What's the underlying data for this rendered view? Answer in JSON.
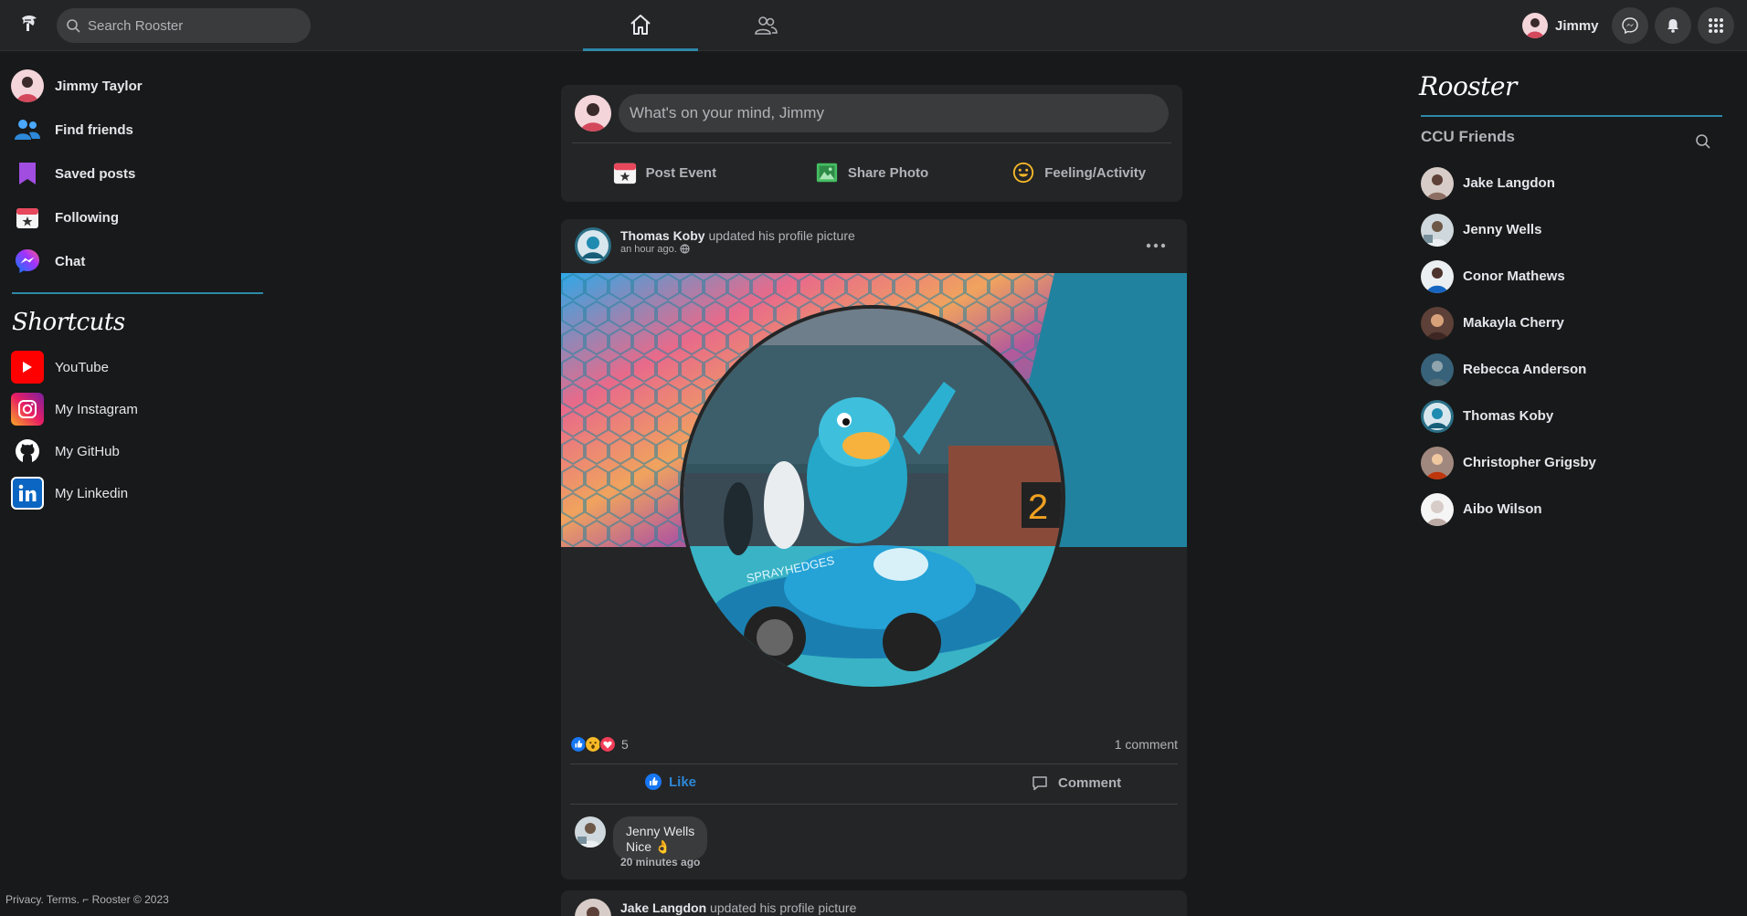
{
  "app": {
    "name": "Rooster"
  },
  "search": {
    "placeholder": "Search Rooster"
  },
  "header": {
    "user_name": "Jimmy"
  },
  "left_nav": [
    {
      "label": "Jimmy Taylor",
      "icon": "avatar"
    },
    {
      "label": "Find friends",
      "icon": "people-icon"
    },
    {
      "label": "Saved posts",
      "icon": "bookmark-icon"
    },
    {
      "label": "Following",
      "icon": "calendar-star-icon"
    },
    {
      "label": "Chat",
      "icon": "messenger-icon"
    }
  ],
  "shortcuts": {
    "title": "Shortcuts",
    "items": [
      {
        "label": "YouTube",
        "icon": "youtube-icon"
      },
      {
        "label": "My Instagram",
        "icon": "instagram-icon"
      },
      {
        "label": "My GitHub",
        "icon": "github-icon"
      },
      {
        "label": "My Linkedin",
        "icon": "linkedin-icon"
      }
    ]
  },
  "footer": {
    "text": "Privacy. Terms. ⌐ Rooster © 2023"
  },
  "composer": {
    "placeholder": "What's on your mind, Jimmy",
    "actions": [
      {
        "label": "Post Event",
        "icon": "calendar-star-icon"
      },
      {
        "label": "Share Photo",
        "icon": "photo-icon"
      },
      {
        "label": "Feeling/Activity",
        "icon": "smiley-icon"
      }
    ]
  },
  "post": {
    "author": "Thomas Koby",
    "action": "updated his profile picture",
    "time": "an hour ago.",
    "reaction_count": "5",
    "comment_count": "1 comment",
    "like_label": "Like",
    "comment_label": "Comment",
    "comments": [
      {
        "author": "Jenny Wells",
        "text": "Nice 👌",
        "time": "20 minutes ago"
      }
    ]
  },
  "post2": {
    "author": "Jake Langdon",
    "action": "updated his profile picture"
  },
  "right": {
    "title": "Rooster",
    "friends_title": "CCU Friends",
    "friends": [
      {
        "name": "Jake Langdon"
      },
      {
        "name": "Jenny Wells"
      },
      {
        "name": "Conor Mathews"
      },
      {
        "name": "Makayla Cherry"
      },
      {
        "name": "Rebecca Anderson"
      },
      {
        "name": "Thomas Koby"
      },
      {
        "name": "Christopher Grigsby"
      },
      {
        "name": "Aibo Wilson"
      }
    ]
  },
  "colors": {
    "accent": "#2d88a8",
    "bg": "#18191a",
    "card": "#242526"
  }
}
